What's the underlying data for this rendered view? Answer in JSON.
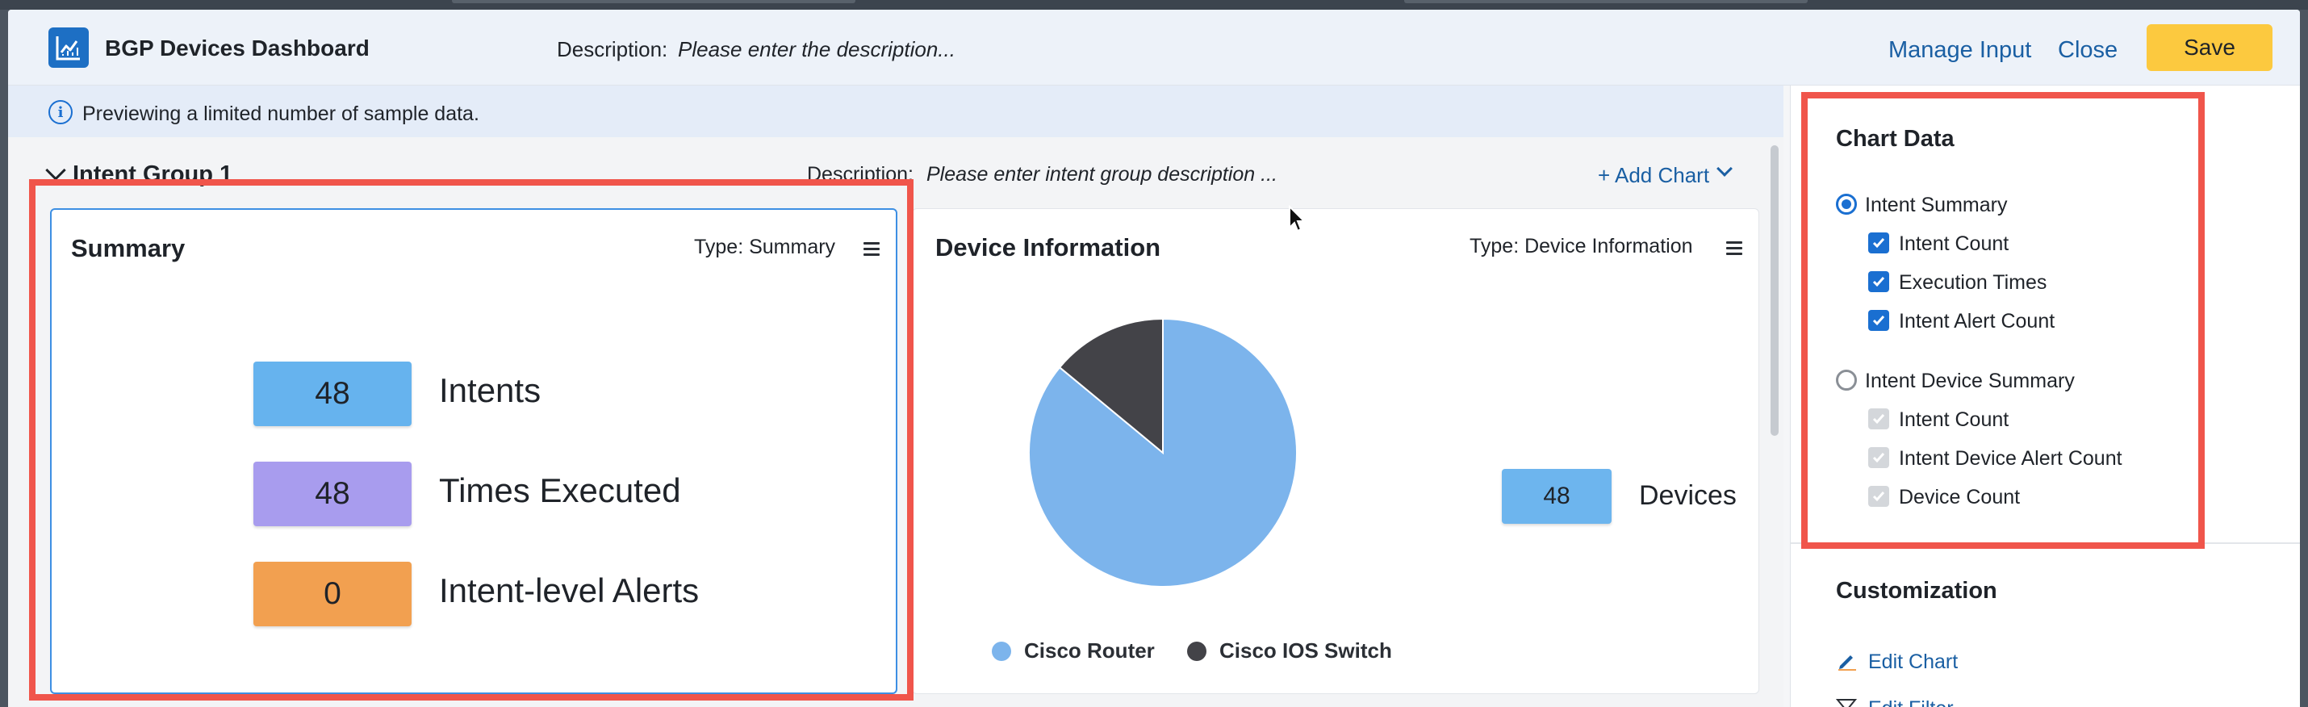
{
  "header": {
    "app_title": "BGP Devices Dashboard",
    "description_label": "Description:",
    "description_placeholder": "Please enter the description...",
    "manage_input_label": "Manage Input",
    "close_label": "Close",
    "save_label": "Save",
    "app_icon": "line-chart-icon"
  },
  "infobar": {
    "icon": "info-icon",
    "text": "Previewing a limited number of sample data."
  },
  "group": {
    "title": "Intent Group 1",
    "description_label": "Description:",
    "description_placeholder": "Please enter intent group description ...",
    "add_chart_label": "+ Add Chart"
  },
  "summary_card": {
    "title": "Summary",
    "type_label": "Type: Summary",
    "stats": [
      {
        "value": "48",
        "label": "Intents",
        "color": "#66b3ee"
      },
      {
        "value": "48",
        "label": "Times Executed",
        "color": "#a89cee"
      },
      {
        "value": "0",
        "label": "Intent-level Alerts",
        "color": "#f2a050"
      }
    ]
  },
  "device_card": {
    "title": "Device Information",
    "type_label": "Type: Device Information",
    "device_count": "48",
    "device_count_label": "Devices",
    "chart_data": {
      "type": "pie",
      "slices": [
        {
          "name": "Cisco Router",
          "value": 0.86,
          "color": "#7cb4ec"
        },
        {
          "name": "Cisco IOS Switch",
          "value": 0.14,
          "color": "#434348"
        }
      ]
    }
  },
  "right_panel": {
    "chart_data_title": "Chart Data",
    "options": [
      {
        "label": "Intent Summary",
        "selected": true,
        "items": [
          "Intent Count",
          "Execution Times",
          "Intent Alert Count"
        ]
      },
      {
        "label": "Intent Device Summary",
        "selected": false,
        "items": [
          "Intent Count",
          "Intent Device Alert Count",
          "Device Count"
        ]
      }
    ],
    "customization_title": "Customization",
    "edit_chart_label": "Edit Chart",
    "edit_filter_label": "Edit Filter"
  },
  "colors": {
    "accent": "#1a6fd1",
    "save": "#fcc93f",
    "highlight": "#f0554b"
  }
}
